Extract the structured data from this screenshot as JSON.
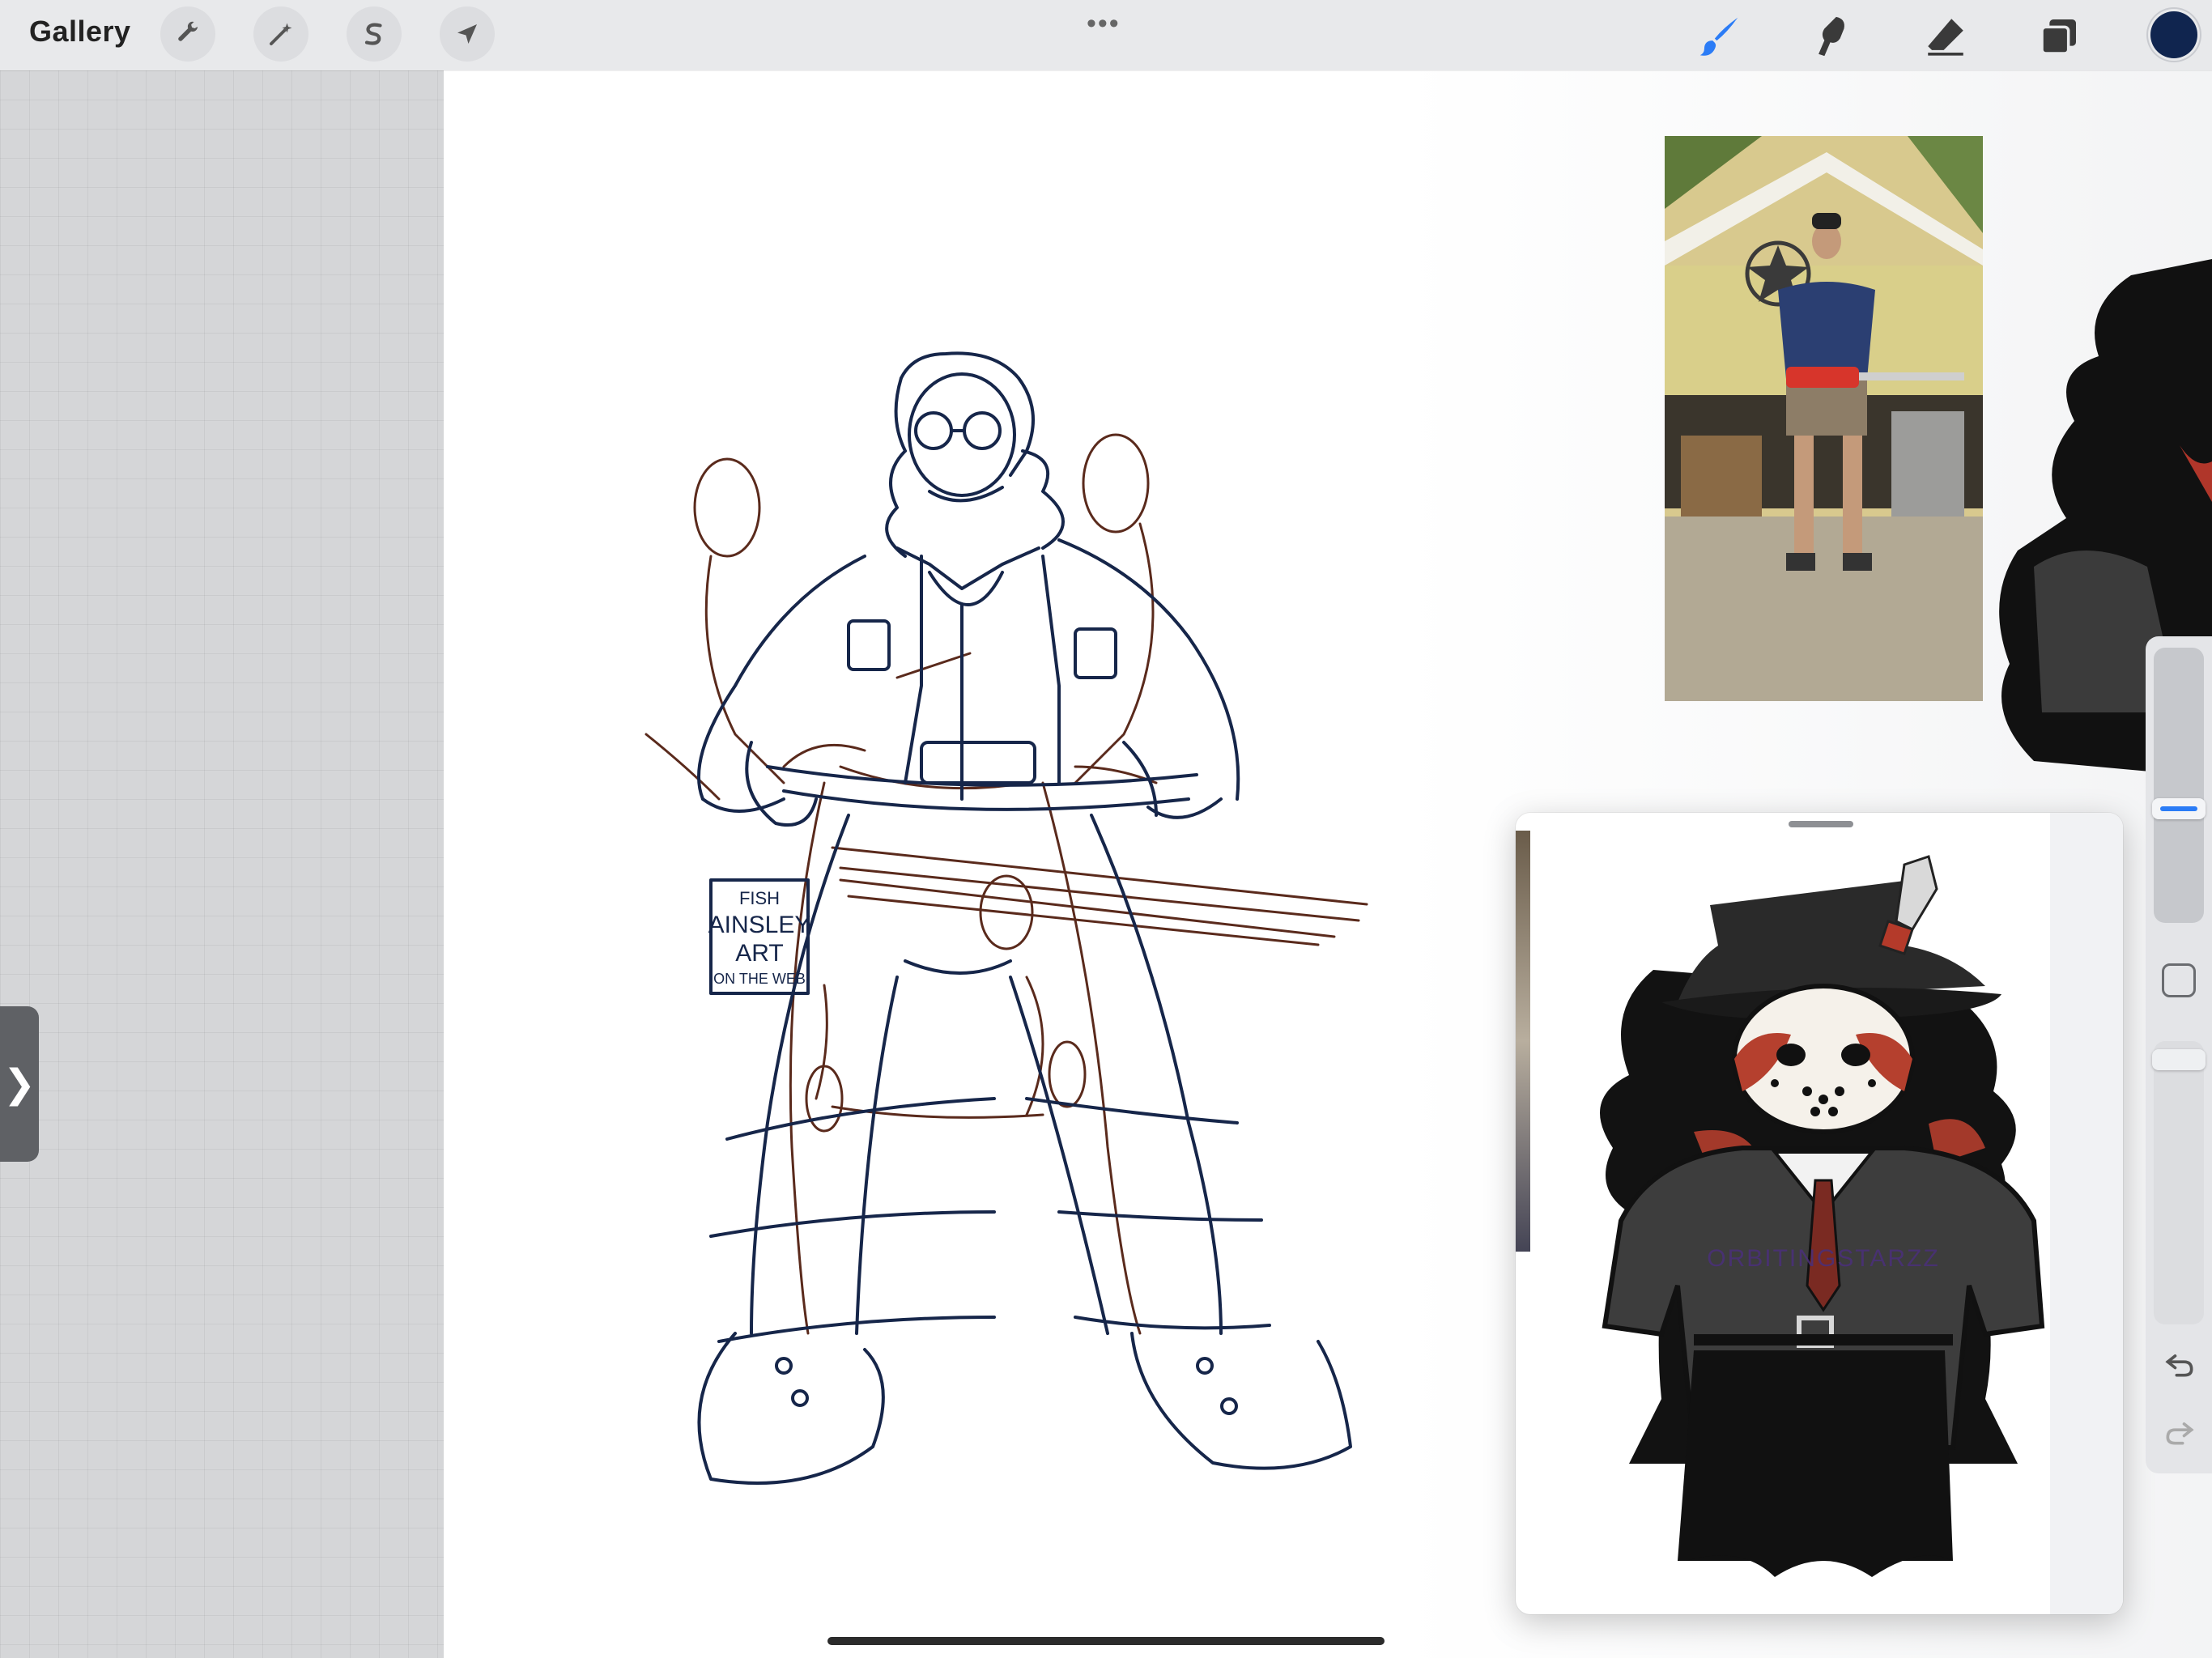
{
  "app": {
    "gallery_label": "Gallery"
  },
  "toolbar_left": {
    "items": [
      {
        "name": "actions",
        "icon": "wrench-icon"
      },
      {
        "name": "adjustments",
        "icon": "magic-wand-icon"
      },
      {
        "name": "selection",
        "icon": "selection-s-icon"
      },
      {
        "name": "transform",
        "icon": "arrow-cursor-icon"
      }
    ]
  },
  "toolbar_right": {
    "items": [
      {
        "name": "brush",
        "icon": "brush-icon",
        "active": true
      },
      {
        "name": "smudge",
        "icon": "smudge-icon"
      },
      {
        "name": "eraser",
        "icon": "eraser-icon"
      },
      {
        "name": "layers",
        "icon": "layers-icon"
      }
    ],
    "current_color": "#10254f"
  },
  "canvas": {
    "stamp_lines": [
      "FISH",
      "AINSLEY",
      "ART",
      "ON THE WEB"
    ],
    "sketch_colors": {
      "line": "#16264a",
      "construction": "#5a2a1c"
    }
  },
  "reference": {
    "watermark": "ORBITINGSTARZZ"
  },
  "colors": {
    "accent_blue": "#2b7cf6",
    "topbar": "#e8e9eb"
  }
}
